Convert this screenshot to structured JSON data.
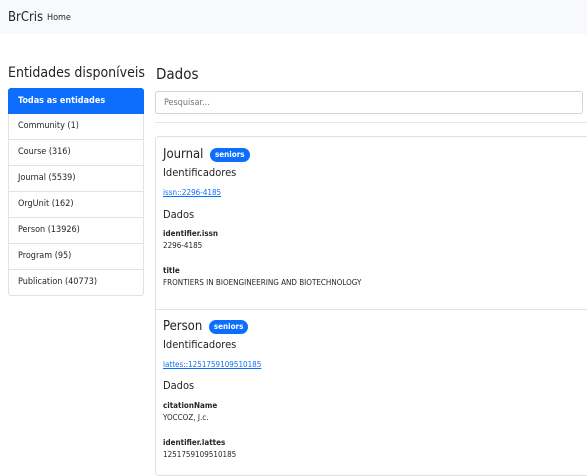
{
  "navbar": {
    "brand": "BrCris",
    "home": "Home"
  },
  "sidebar": {
    "title": "Entidades disponíveis",
    "items": [
      {
        "label": "Todas as entidades",
        "active": true
      },
      {
        "label": "Community (1)"
      },
      {
        "label": "Course (316)"
      },
      {
        "label": "Journal (5539)"
      },
      {
        "label": "OrgUnit (162)"
      },
      {
        "label": "Person (13926)"
      },
      {
        "label": "Program (95)"
      },
      {
        "label": "Publication (40773)"
      }
    ]
  },
  "main": {
    "title": "Dados",
    "search": {
      "placeholder": "Pesquisar...",
      "value": ""
    },
    "results": [
      {
        "type": "Journal",
        "badge": "seniors",
        "identifiers_heading": "Identificadores",
        "identifier_link": "issn::2296-4185",
        "data_heading": "Dados",
        "fields": [
          {
            "name": "identifier.issn",
            "value": "2296-4185"
          },
          {
            "name": "title",
            "value": "FRONTIERS IN BIOENGINEERING AND BIOTECHNOLOGY"
          }
        ]
      },
      {
        "type": "Person",
        "badge": "seniors",
        "identifiers_heading": "Identificadores",
        "identifier_link": "lattes::1251759109510185",
        "data_heading": "Dados",
        "fields": [
          {
            "name": "citationName",
            "value": "YOCCOZ, J.c."
          },
          {
            "name": "identifier.lattes",
            "value": "1251759109510185"
          }
        ]
      }
    ]
  },
  "colors": {
    "primary": "#0d6efd",
    "navbar_bg": "#f8f9fa",
    "border": "#dee2e6"
  }
}
